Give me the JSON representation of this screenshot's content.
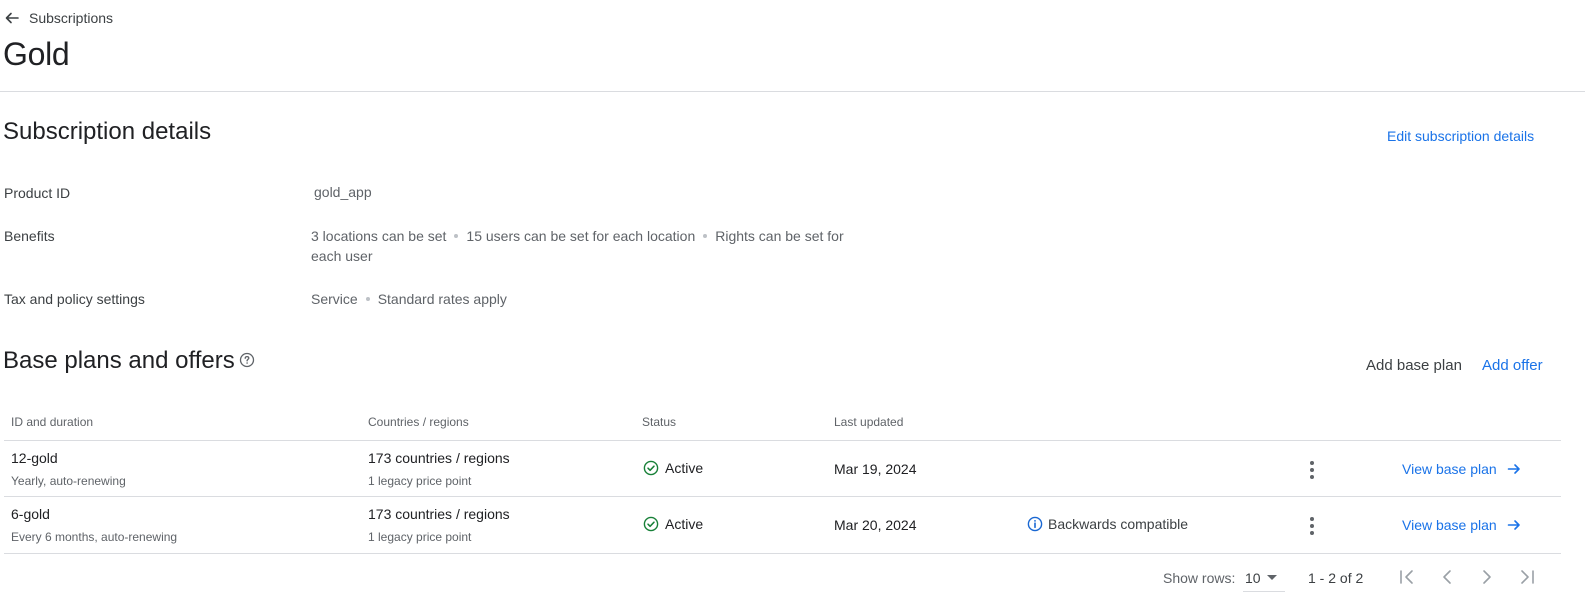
{
  "breadcrumb": {
    "label": "Subscriptions"
  },
  "page": {
    "title": "Gold"
  },
  "details": {
    "title": "Subscription details",
    "edit_label": "Edit subscription details",
    "product_id": {
      "label": "Product ID",
      "value": "gold_app"
    },
    "benefits": {
      "label": "Benefits",
      "items": [
        "3 locations can be set",
        "15 users can be set for each location",
        "Rights can be set for each user"
      ]
    },
    "tax": {
      "label": "Tax and policy settings",
      "items": [
        "Service",
        "Standard rates apply"
      ]
    }
  },
  "plans": {
    "title": "Base plans and offers",
    "add_base_plan_label": "Add base plan",
    "add_offer_label": "Add offer",
    "columns": [
      "ID and duration",
      "Countries / regions",
      "Status",
      "Last updated"
    ],
    "rows": [
      {
        "id": "12-gold",
        "duration": "Yearly, auto-renewing",
        "regions": "173 countries / regions",
        "price_points": "1 legacy price point",
        "status": "Active",
        "updated": "Mar 19, 2024",
        "note": "",
        "action": "View base plan"
      },
      {
        "id": "6-gold",
        "duration": "Every 6 months, auto-renewing",
        "regions": "173 countries / regions",
        "price_points": "1 legacy price point",
        "status": "Active",
        "updated": "Mar 20, 2024",
        "note": "Backwards compatible",
        "action": "View base plan"
      }
    ]
  },
  "pagination": {
    "show_rows_label": "Show rows:",
    "rows_value": "10",
    "range": "1 - 2 of 2"
  },
  "colors": {
    "accent": "#1a73e8",
    "success": "#188038",
    "info": "#1967d2"
  }
}
